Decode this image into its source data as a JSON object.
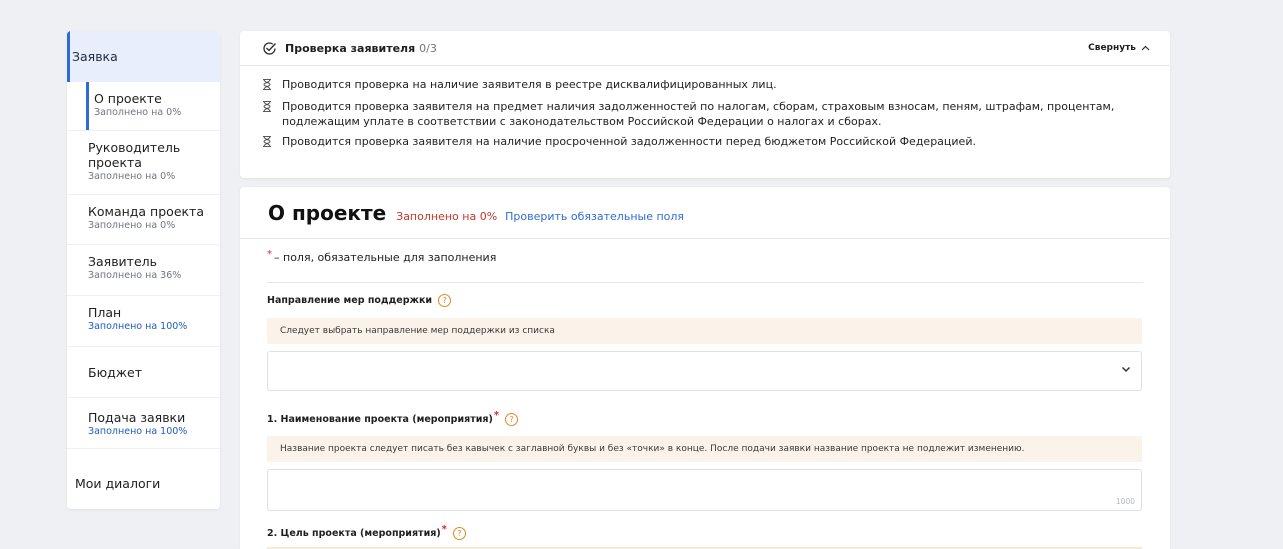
{
  "sidebar": {
    "main_label": "Заявка",
    "items": [
      {
        "label": "О проекте",
        "meta": "Заполнено на 0%",
        "active": true,
        "done": false
      },
      {
        "label": "Руководитель проекта",
        "meta": "Заполнено на 0%",
        "active": false,
        "done": false
      },
      {
        "label": "Команда проекта",
        "meta": "Заполнено на 0%",
        "active": false,
        "done": false
      },
      {
        "label": "Заявитель",
        "meta": "Заполнено на 36%",
        "active": false,
        "done": false
      },
      {
        "label": "План",
        "meta": "Заполнено на 100%",
        "active": false,
        "done": true
      },
      {
        "label": "Бюджет",
        "meta": "",
        "active": false,
        "done": false
      },
      {
        "label": "Подача заявки",
        "meta": "Заполнено на 100%",
        "active": false,
        "done": true
      }
    ],
    "dialogs_label": "Мои диалоги"
  },
  "check": {
    "title": "Проверка заявителя",
    "count": "0/3",
    "collapse_label": "Свернуть",
    "items": [
      "Проводится проверка на наличие заявителя в реестре дисквалифицированных лиц.",
      "Проводится проверка заявителя на предмет наличия задолженностей по налогам, сборам, страховым взносам, пеням, штрафам, процентам, подлежащим уплате в соответствии с законодательством Российской Федерации о налогах и сборах.",
      "Проводится проверка заявителя на наличие просроченной задолженности перед бюджетом Российской Федерацией."
    ]
  },
  "form": {
    "heading": "О проекте",
    "fill_status": "Заполнено на 0%",
    "check_link": "Проверить обязательные поля",
    "required_note": "– поля, обязательные для заполнения",
    "direction": {
      "label": "Направление мер поддержки",
      "hint": "Следует выбрать направление мер поддержки из списка",
      "value": ""
    },
    "name": {
      "label": "1. Наименование проекта (мероприятия)",
      "hint": "Название проекта следует писать без кавычек с заглавной буквы и без «точки» в конце. После подачи заявки название проекта не подлежит изменению.",
      "value": "",
      "counter": "1000"
    },
    "goal": {
      "label": "2. Цель проекта (мероприятия)"
    }
  },
  "colors": {
    "accent": "#2f6bd6",
    "danger": "#c0392b",
    "hint_bg": "#fbf2ea",
    "help": "#e08a1e"
  }
}
